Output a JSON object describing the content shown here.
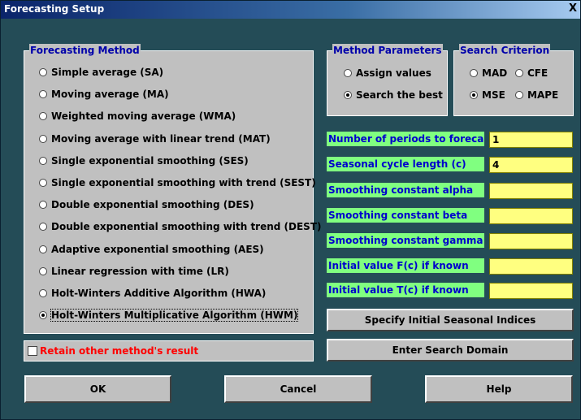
{
  "window": {
    "title": "Forecasting Setup",
    "close_glyph": "X"
  },
  "method_group": {
    "legend": "Forecasting Method",
    "options": [
      {
        "label": "Simple average (SA)",
        "selected": false
      },
      {
        "label": "Moving average (MA)",
        "selected": false
      },
      {
        "label": "Weighted moving average (WMA)",
        "selected": false
      },
      {
        "label": "Moving average with linear trend (MAT)",
        "selected": false
      },
      {
        "label": "Single exponential smoothing (SES)",
        "selected": false
      },
      {
        "label": "Single exponential smoothing with trend (SEST)",
        "selected": false
      },
      {
        "label": "Double exponential smoothing (DES)",
        "selected": false
      },
      {
        "label": "Double exponential smoothing with trend (DEST)",
        "selected": false
      },
      {
        "label": "Adaptive exponential smoothing (AES)",
        "selected": false
      },
      {
        "label": "Linear regression with time (LR)",
        "selected": false
      },
      {
        "label": "Holt-Winters Additive Algorithm (HWA)",
        "selected": false
      },
      {
        "label": "Holt-Winters Multiplicative Algorithm (HWM)",
        "selected": true
      }
    ]
  },
  "param_group": {
    "legend": "Method Parameters",
    "options": [
      {
        "label": "Assign values",
        "selected": false
      },
      {
        "label": "Search the best",
        "selected": true
      }
    ]
  },
  "criterion_group": {
    "legend": "Search Criterion",
    "options": [
      {
        "label": "MAD",
        "selected": false
      },
      {
        "label": "CFE",
        "selected": false
      },
      {
        "label": "MSE",
        "selected": true
      },
      {
        "label": "MAPE",
        "selected": false
      }
    ]
  },
  "params": [
    {
      "label": "Number of periods to forecast",
      "value": "1"
    },
    {
      "label": "Seasonal cycle length (c)",
      "value": "4"
    },
    {
      "label": "Smoothing constant alpha",
      "value": ""
    },
    {
      "label": "Smoothing constant beta",
      "value": ""
    },
    {
      "label": "Smoothing constant gamma",
      "value": ""
    },
    {
      "label": "Initial value F(c) if known",
      "value": ""
    },
    {
      "label": "Initial value T(c) if known",
      "value": ""
    }
  ],
  "buttons": {
    "seasonal": "Specify Initial Seasonal Indices",
    "search_domain": "Enter Search Domain",
    "ok": "OK",
    "cancel": "Cancel",
    "help": "Help"
  },
  "retain": {
    "label": "Retain other method's result",
    "checked": false
  },
  "colors": {
    "title_bar": "#0a246a",
    "panel": "#c0c0c0",
    "param_label_bg": "#80ff80",
    "param_field_bg": "#ffff80",
    "legend_text": "#0000aa",
    "retain_text": "#ff0000",
    "window_bg": "#244c57"
  }
}
